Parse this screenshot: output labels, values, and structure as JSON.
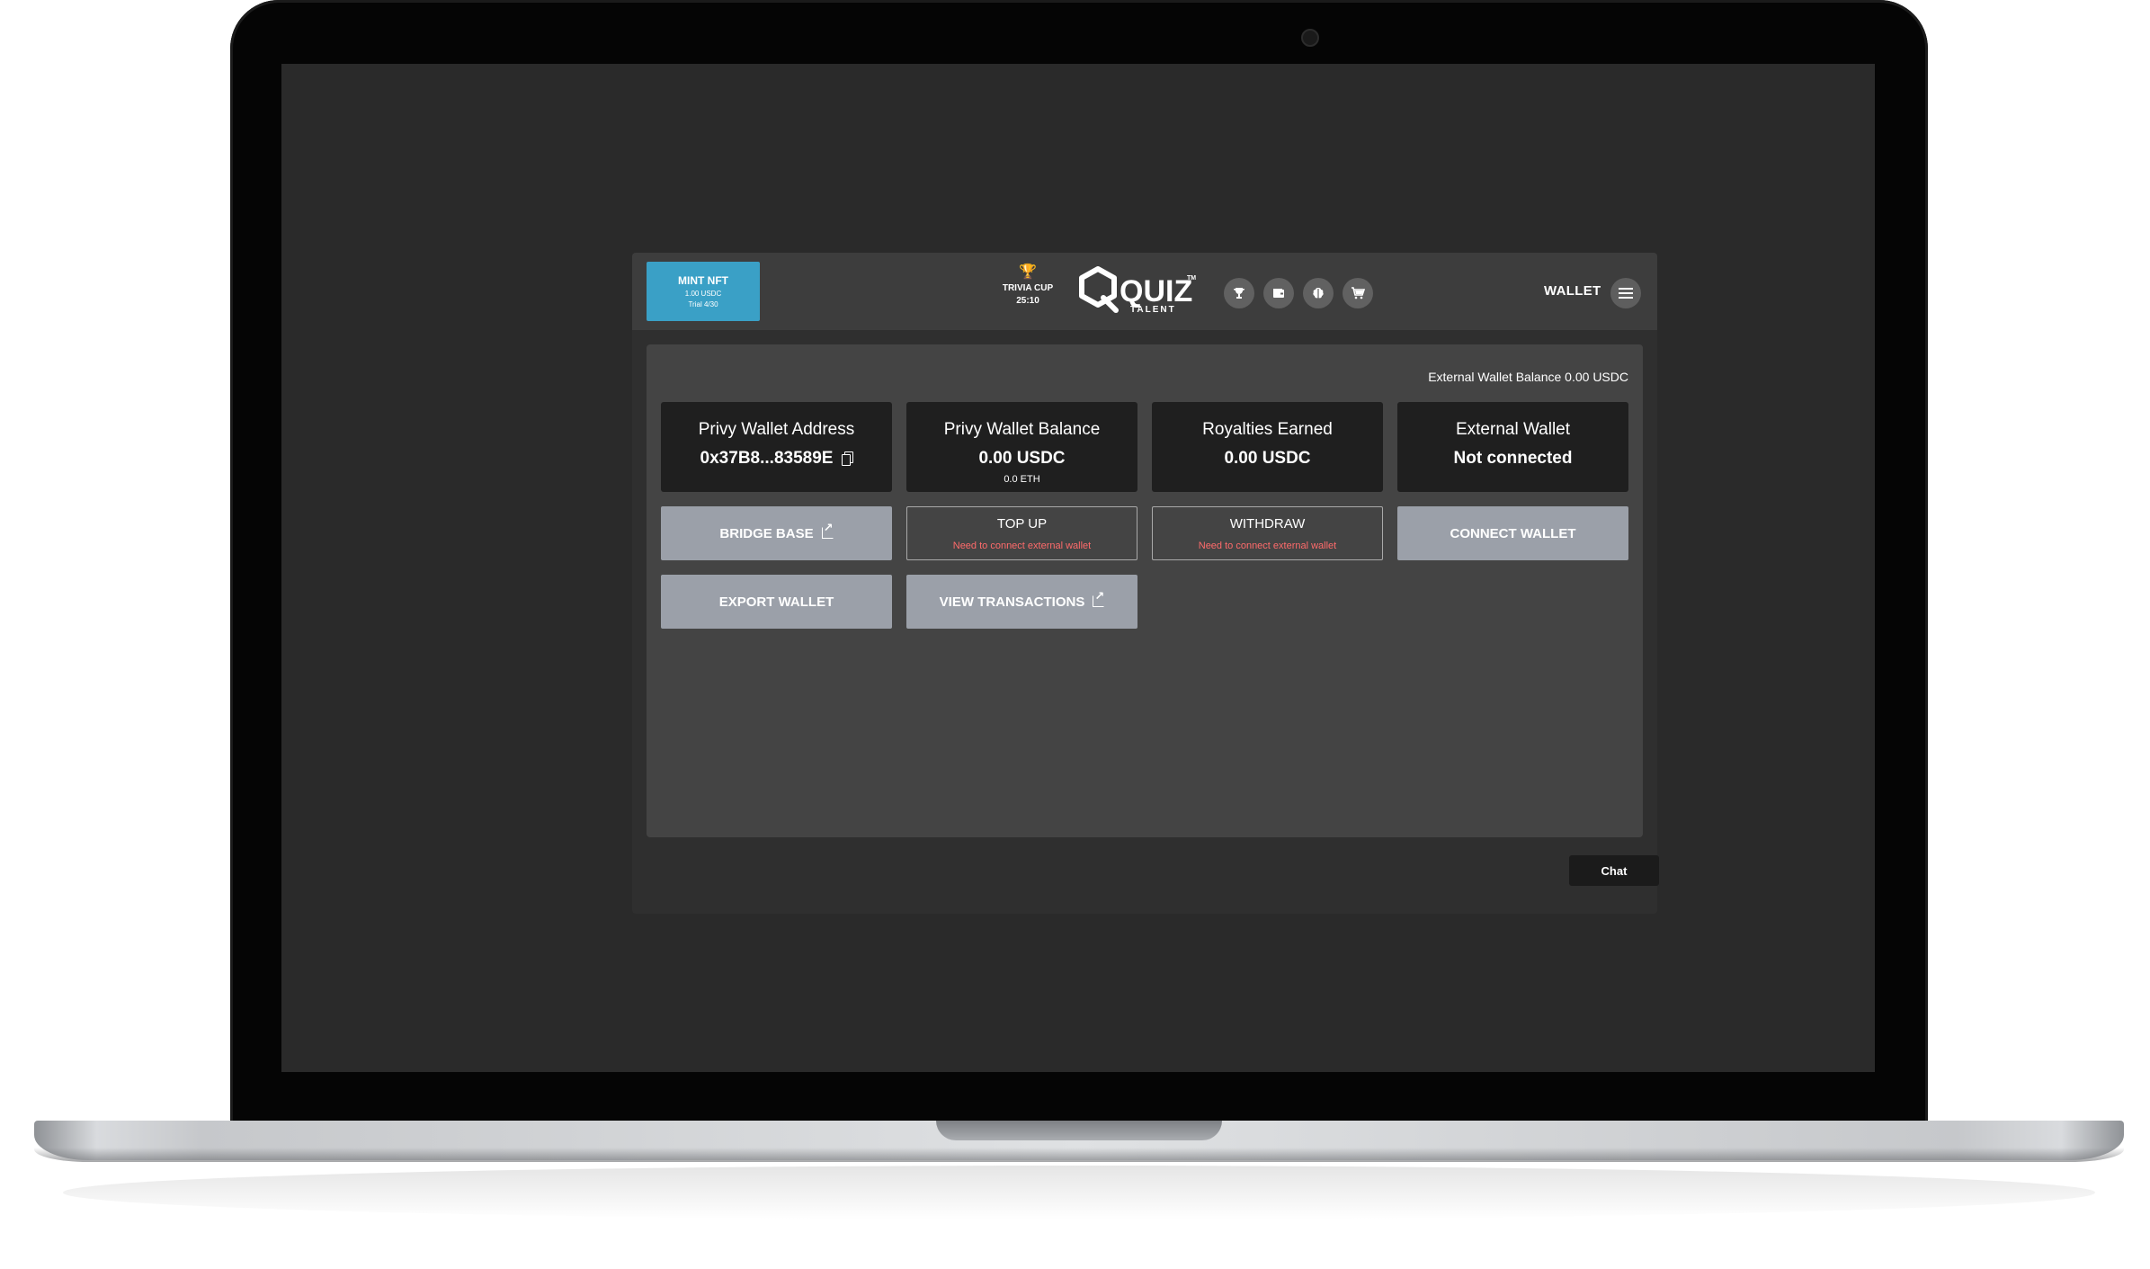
{
  "header": {
    "mint": {
      "title": "MINT NFT",
      "price": "1.00 USDC",
      "trial": "Trial 4/30"
    },
    "trivia": {
      "label": "TRIVIA CUP",
      "time": "25:10",
      "icon": "trophy-icon"
    },
    "logo": {
      "main": "QUIZ",
      "tm": "TM",
      "sub": "TALENT"
    },
    "icons": [
      "trophy-icon",
      "wallet-icon",
      "brain-icon",
      "cart-icon"
    ],
    "wallet_label": "WALLET",
    "menu_icon": "hamburger-menu-icon"
  },
  "panel": {
    "external_balance": "External Wallet Balance 0.00 USDC",
    "cards": [
      {
        "title": "Privy Wallet Address",
        "value": "0x37B8...83589E",
        "sub": ""
      },
      {
        "title": "Privy Wallet Balance",
        "value": "0.00 USDC",
        "sub": "0.0 ETH"
      },
      {
        "title": "Royalties Earned",
        "value": "0.00 USDC",
        "sub": ""
      },
      {
        "title": "External Wallet",
        "value": "Not connected",
        "sub": ""
      }
    ],
    "buttons": {
      "bridge": "BRIDGE BASE",
      "topup": "TOP UP",
      "topup_warning": "Need to connect external wallet",
      "withdraw": "WITHDRAW",
      "withdraw_warning": "Need to connect external wallet",
      "connect": "CONNECT WALLET",
      "export": "EXPORT WALLET",
      "transactions": "VIEW TRANSACTIONS"
    }
  },
  "chat": {
    "label": "Chat"
  },
  "colors": {
    "mint_bg": "#3aa0c6",
    "button_bg": "#9ba0a9",
    "warning": "#ff6b6b",
    "trophy": "#e3a93a"
  }
}
